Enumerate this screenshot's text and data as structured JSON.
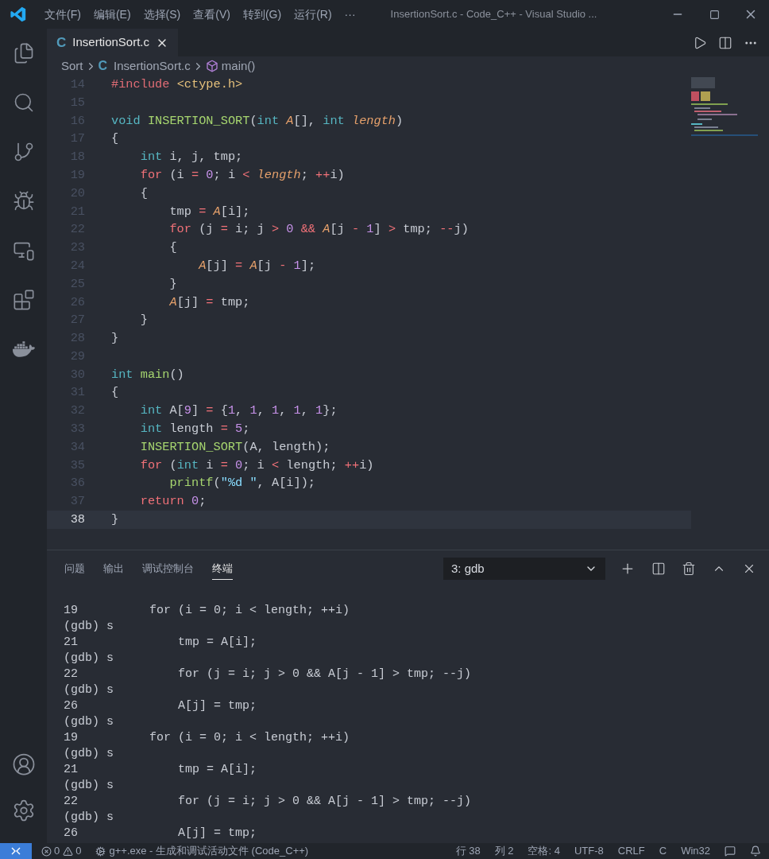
{
  "title_bar": {
    "menus": [
      "文件(F)",
      "编辑(E)",
      "选择(S)",
      "查看(V)",
      "转到(G)",
      "运行(R)",
      "···"
    ],
    "title": "InsertionSort.c - Code_C++ - Visual Studio ..."
  },
  "activity_bar": {
    "items": [
      {
        "kind": "files",
        "selected": false
      },
      {
        "kind": "search",
        "selected": false
      },
      {
        "kind": "source-control",
        "selected": false
      },
      {
        "kind": "debug",
        "selected": false
      },
      {
        "kind": "remote",
        "selected": false
      },
      {
        "kind": "extensions",
        "selected": false
      },
      {
        "kind": "docker",
        "selected": false
      }
    ],
    "bottom": [
      {
        "kind": "account"
      },
      {
        "kind": "settings"
      }
    ]
  },
  "editor_tabs": [
    {
      "icon_letter": "C",
      "label": "InsertionSort.c",
      "selected": true
    }
  ],
  "breadcrumb": [
    {
      "kind": "folder",
      "label": "Sort"
    },
    {
      "kind": "file",
      "icon_letter": "C",
      "label": "InsertionSort.c"
    },
    {
      "kind": "symbol",
      "label": "main()"
    }
  ],
  "editor": {
    "lines": [
      {
        "number": "14",
        "current": false,
        "tokens": [
          {
            "text": "#include ",
            "kind": "pre"
          },
          {
            "text": "<ctype.h>",
            "kind": "inc"
          }
        ]
      },
      {
        "number": "15",
        "current": false
      },
      {
        "number": "16",
        "current": false,
        "tokens": [
          {
            "text": "void ",
            "kind": "type"
          },
          {
            "text": "INSERTION_SORT",
            "kind": "fn"
          },
          {
            "text": "(",
            "kind": "plain"
          },
          {
            "text": "int ",
            "kind": "type"
          },
          {
            "text": "A",
            "kind": "param"
          },
          {
            "text": "[], ",
            "kind": "plain"
          },
          {
            "text": "int ",
            "kind": "type"
          },
          {
            "text": "length",
            "kind": "param"
          },
          {
            "text": ")",
            "kind": "plain"
          }
        ]
      },
      {
        "number": "17",
        "current": false,
        "tokens": [
          {
            "text": "{",
            "kind": "plain"
          }
        ]
      },
      {
        "number": "18",
        "current": false,
        "tokens": [
          {
            "text": "    int",
            "kind": "type"
          },
          {
            "text": " i, j, tmp;",
            "kind": "plain"
          }
        ]
      },
      {
        "number": "19",
        "current": false,
        "tokens": [
          {
            "text": "    for",
            "kind": "ctl"
          },
          {
            "text": " (i ",
            "kind": "plain"
          },
          {
            "text": "= ",
            "kind": "op"
          },
          {
            "text": "0",
            "kind": "num"
          },
          {
            "text": "; i ",
            "kind": "plain"
          },
          {
            "text": "< ",
            "kind": "op"
          },
          {
            "text": "length",
            "kind": "param"
          },
          {
            "text": "; ",
            "kind": "plain"
          },
          {
            "text": "++",
            "kind": "op"
          },
          {
            "text": "i)",
            "kind": "plain"
          }
        ]
      },
      {
        "number": "20",
        "current": false,
        "tokens": [
          {
            "text": "    {",
            "kind": "plain"
          }
        ]
      },
      {
        "number": "21",
        "current": false,
        "tokens": [
          {
            "text": "        tmp ",
            "kind": "plain"
          },
          {
            "text": "= ",
            "kind": "op"
          },
          {
            "text": "A",
            "kind": "param"
          },
          {
            "text": "[i];",
            "kind": "plain"
          }
        ]
      },
      {
        "number": "22",
        "current": false,
        "tokens": [
          {
            "text": "        for",
            "kind": "ctl"
          },
          {
            "text": " (j ",
            "kind": "plain"
          },
          {
            "text": "=",
            "kind": "op"
          },
          {
            "text": " i; j ",
            "kind": "plain"
          },
          {
            "text": "> ",
            "kind": "op"
          },
          {
            "text": "0 ",
            "kind": "num"
          },
          {
            "text": "&& ",
            "kind": "op"
          },
          {
            "text": "A",
            "kind": "param"
          },
          {
            "text": "[j ",
            "kind": "plain"
          },
          {
            "text": "- ",
            "kind": "op"
          },
          {
            "text": "1",
            "kind": "num"
          },
          {
            "text": "] ",
            "kind": "plain"
          },
          {
            "text": ">",
            "kind": "op"
          },
          {
            "text": " tmp; ",
            "kind": "plain"
          },
          {
            "text": "--",
            "kind": "op"
          },
          {
            "text": "j)",
            "kind": "plain"
          }
        ]
      },
      {
        "number": "23",
        "current": false,
        "tokens": [
          {
            "text": "        {",
            "kind": "plain"
          }
        ]
      },
      {
        "number": "24",
        "current": false,
        "tokens": [
          {
            "text": "            A",
            "kind": "param"
          },
          {
            "text": "[j] ",
            "kind": "plain"
          },
          {
            "text": "= ",
            "kind": "op"
          },
          {
            "text": "A",
            "kind": "param"
          },
          {
            "text": "[j ",
            "kind": "plain"
          },
          {
            "text": "- ",
            "kind": "op"
          },
          {
            "text": "1",
            "kind": "num"
          },
          {
            "text": "];",
            "kind": "plain"
          }
        ]
      },
      {
        "number": "25",
        "current": false,
        "tokens": [
          {
            "text": "        }",
            "kind": "plain"
          }
        ]
      },
      {
        "number": "26",
        "current": false,
        "tokens": [
          {
            "text": "        A",
            "kind": "param"
          },
          {
            "text": "[j] ",
            "kind": "plain"
          },
          {
            "text": "=",
            "kind": "op"
          },
          {
            "text": " tmp;",
            "kind": "plain"
          }
        ]
      },
      {
        "number": "27",
        "current": false,
        "tokens": [
          {
            "text": "    }",
            "kind": "plain"
          }
        ]
      },
      {
        "number": "28",
        "current": false,
        "tokens": [
          {
            "text": "}",
            "kind": "plain"
          }
        ]
      },
      {
        "number": "29",
        "current": false
      },
      {
        "number": "30",
        "current": false,
        "tokens": [
          {
            "text": "int ",
            "kind": "type"
          },
          {
            "text": "main",
            "kind": "fn"
          },
          {
            "text": "()",
            "kind": "plain"
          }
        ]
      },
      {
        "number": "31",
        "current": false,
        "tokens": [
          {
            "text": "{",
            "kind": "plain"
          }
        ]
      },
      {
        "number": "32",
        "current": false,
        "tokens": [
          {
            "text": "    int",
            "kind": "type"
          },
          {
            "text": " A[",
            "kind": "plain"
          },
          {
            "text": "9",
            "kind": "num"
          },
          {
            "text": "] ",
            "kind": "plain"
          },
          {
            "text": "=",
            "kind": "op"
          },
          {
            "text": " {",
            "kind": "plain"
          },
          {
            "text": "1",
            "kind": "num"
          },
          {
            "text": ", ",
            "kind": "plain"
          },
          {
            "text": "1",
            "kind": "num"
          },
          {
            "text": ", ",
            "kind": "plain"
          },
          {
            "text": "1",
            "kind": "num"
          },
          {
            "text": ", ",
            "kind": "plain"
          },
          {
            "text": "1",
            "kind": "num"
          },
          {
            "text": ", ",
            "kind": "plain"
          },
          {
            "text": "1",
            "kind": "num"
          },
          {
            "text": "};",
            "kind": "plain"
          }
        ]
      },
      {
        "number": "33",
        "current": false,
        "tokens": [
          {
            "text": "    int",
            "kind": "type"
          },
          {
            "text": " length ",
            "kind": "plain"
          },
          {
            "text": "= ",
            "kind": "op"
          },
          {
            "text": "5",
            "kind": "num"
          },
          {
            "text": ";",
            "kind": "plain"
          }
        ]
      },
      {
        "number": "34",
        "current": false,
        "tokens": [
          {
            "text": "    INSERTION_SORT",
            "kind": "fn"
          },
          {
            "text": "(A, length);",
            "kind": "plain"
          }
        ]
      },
      {
        "number": "35",
        "current": false,
        "tokens": [
          {
            "text": "    for",
            "kind": "ctl"
          },
          {
            "text": " (",
            "kind": "plain"
          },
          {
            "text": "int",
            "kind": "type"
          },
          {
            "text": " i ",
            "kind": "plain"
          },
          {
            "text": "= ",
            "kind": "op"
          },
          {
            "text": "0",
            "kind": "num"
          },
          {
            "text": "; i ",
            "kind": "plain"
          },
          {
            "text": "<",
            "kind": "op"
          },
          {
            "text": " length; ",
            "kind": "plain"
          },
          {
            "text": "++",
            "kind": "op"
          },
          {
            "text": "i)",
            "kind": "plain"
          }
        ]
      },
      {
        "number": "36",
        "current": false,
        "tokens": [
          {
            "text": "        printf",
            "kind": "fn"
          },
          {
            "text": "(",
            "kind": "plain"
          },
          {
            "text": "\"%d \"",
            "kind": "str"
          },
          {
            "text": ", A[i]);",
            "kind": "plain"
          }
        ]
      },
      {
        "number": "37",
        "current": false,
        "tokens": [
          {
            "text": "    return ",
            "kind": "ctl"
          },
          {
            "text": "0",
            "kind": "num"
          },
          {
            "text": ";",
            "kind": "plain"
          }
        ]
      },
      {
        "number": "38",
        "current": true,
        "tokens": [
          {
            "text": "}",
            "kind": "plain"
          }
        ]
      }
    ]
  },
  "panel": {
    "tabs": [
      {
        "label": "问题",
        "selected": false
      },
      {
        "label": "输出",
        "selected": false
      },
      {
        "label": "调试控制台",
        "selected": false
      },
      {
        "label": "终端",
        "selected": true
      }
    ],
    "terminal_select": "3: gdb",
    "terminal_lines": [
      "19          for (i = 0; i < length; ++i)",
      "(gdb) s",
      "21              tmp = A[i];",
      "(gdb) s",
      "22              for (j = i; j > 0 && A[j - 1] > tmp; --j)",
      "(gdb) s",
      "26              A[j] = tmp;",
      "(gdb) s",
      "19          for (i = 0; i < length; ++i)",
      "(gdb) s",
      "21              tmp = A[i];",
      "(gdb) s",
      "22              for (j = i; j > 0 && A[j - 1] > tmp; --j)",
      "(gdb) s",
      "26              A[j] = tmp;"
    ]
  },
  "status_bar": {
    "errors": "0",
    "warnings": "0",
    "launch": "g++.exe - 生成和调试活动文件 (Code_C++)",
    "right": [
      "行 38",
      "列 2",
      "空格: 4",
      "UTF-8",
      "CRLF",
      "C",
      "Win32"
    ]
  }
}
